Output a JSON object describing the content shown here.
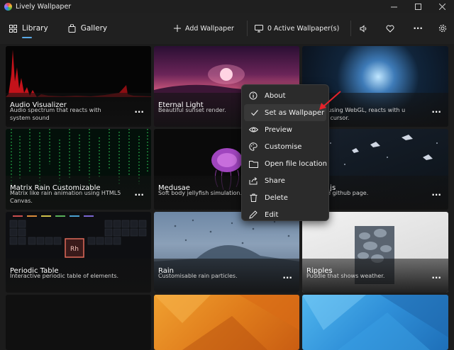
{
  "window": {
    "title": "Lively Wallpaper"
  },
  "toolbar": {
    "nav": [
      {
        "label": "Library",
        "icon": "grid-icon"
      },
      {
        "label": "Gallery",
        "icon": "bag-icon"
      }
    ],
    "add_label": "Add Wallpaper",
    "active_label": "0 Active Wallpaper(s)"
  },
  "tiles": [
    {
      "title": "Audio Visualizer",
      "desc": "Audio spectrum that reacts with system sound"
    },
    {
      "title": "Eternal Light",
      "desc": "Beautiful sunset render."
    },
    {
      "title": "",
      "desc": "ulation using WebGL, reacts with u audio & cursor."
    },
    {
      "title": "Matrix Rain Customizable",
      "desc": "Matrix like rain animation using HTML5 Canvas."
    },
    {
      "title": "Medusae",
      "desc": "Soft body jellyfish simulation."
    },
    {
      "title": ".js",
      "desc": "s engine github page."
    },
    {
      "title": "Periodic Table",
      "desc": "Interactive periodic table of elements."
    },
    {
      "title": "Rain",
      "desc": "Customisable rain particles."
    },
    {
      "title": "Ripples",
      "desc": "Puddle that shows weather."
    }
  ],
  "periodic_symbol": "Rh",
  "context_menu": {
    "items": [
      {
        "label": "About",
        "icon": "info-icon"
      },
      {
        "label": "Set as Wallpaper",
        "icon": "check-icon"
      },
      {
        "label": "Preview",
        "icon": "eye-icon"
      },
      {
        "label": "Customise",
        "icon": "palette-icon"
      },
      {
        "label": "Open file location",
        "icon": "folder-icon"
      },
      {
        "label": "Share",
        "icon": "share-icon"
      },
      {
        "label": "Delete",
        "icon": "trash-icon"
      },
      {
        "label": "Edit",
        "icon": "pencil-icon"
      }
    ]
  },
  "colors": {
    "accent": "#5aa9e6",
    "arrow": "#e5232b",
    "menu_bg": "#2b2b2b"
  }
}
